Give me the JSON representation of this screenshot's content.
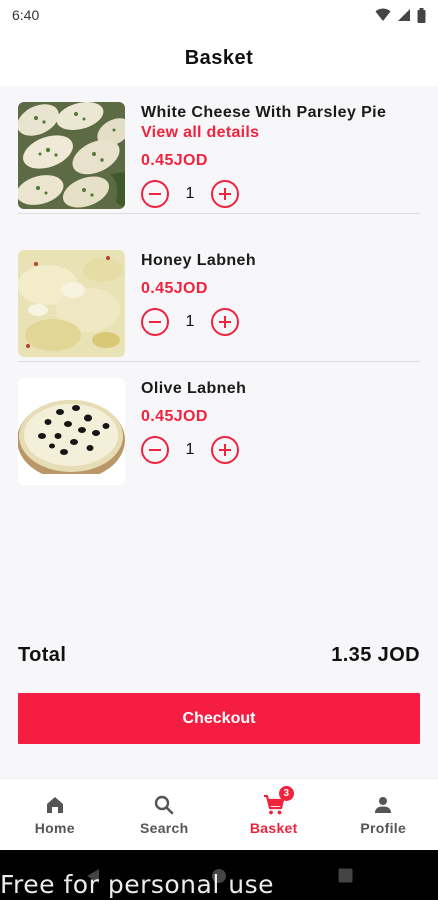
{
  "status": {
    "time": "6:40",
    "icons": [
      "wifi-icon",
      "signal-icon",
      "battery-icon"
    ]
  },
  "header": {
    "title": "Basket"
  },
  "items": [
    {
      "name": "White Cheese With Parsley Pie",
      "link": "View all details",
      "price": "0.45JOD",
      "quantity": "1",
      "image": "parsley-pie-image"
    },
    {
      "name": "Honey Labneh",
      "link": "",
      "price": "0.45JOD",
      "quantity": "1",
      "image": "honey-labneh-image"
    },
    {
      "name": "Olive Labneh",
      "link": "",
      "price": "0.45JOD",
      "quantity": "1",
      "image": "olive-labneh-image"
    }
  ],
  "total": {
    "label": "Total",
    "amount": "1.35 JOD"
  },
  "checkout": {
    "label": "Checkout"
  },
  "nav": {
    "items": [
      {
        "label": "Home",
        "icon": "home-icon",
        "active": false
      },
      {
        "label": "Search",
        "icon": "search-icon",
        "active": false
      },
      {
        "label": "Basket",
        "icon": "cart-icon",
        "active": true,
        "badge": "3"
      },
      {
        "label": "Profile",
        "icon": "person-icon",
        "active": false
      }
    ]
  },
  "watermark": "Free for personal use",
  "colors": {
    "accent": "#f0233f",
    "checkout": "#f61d43",
    "background": "#f7f7f9"
  }
}
